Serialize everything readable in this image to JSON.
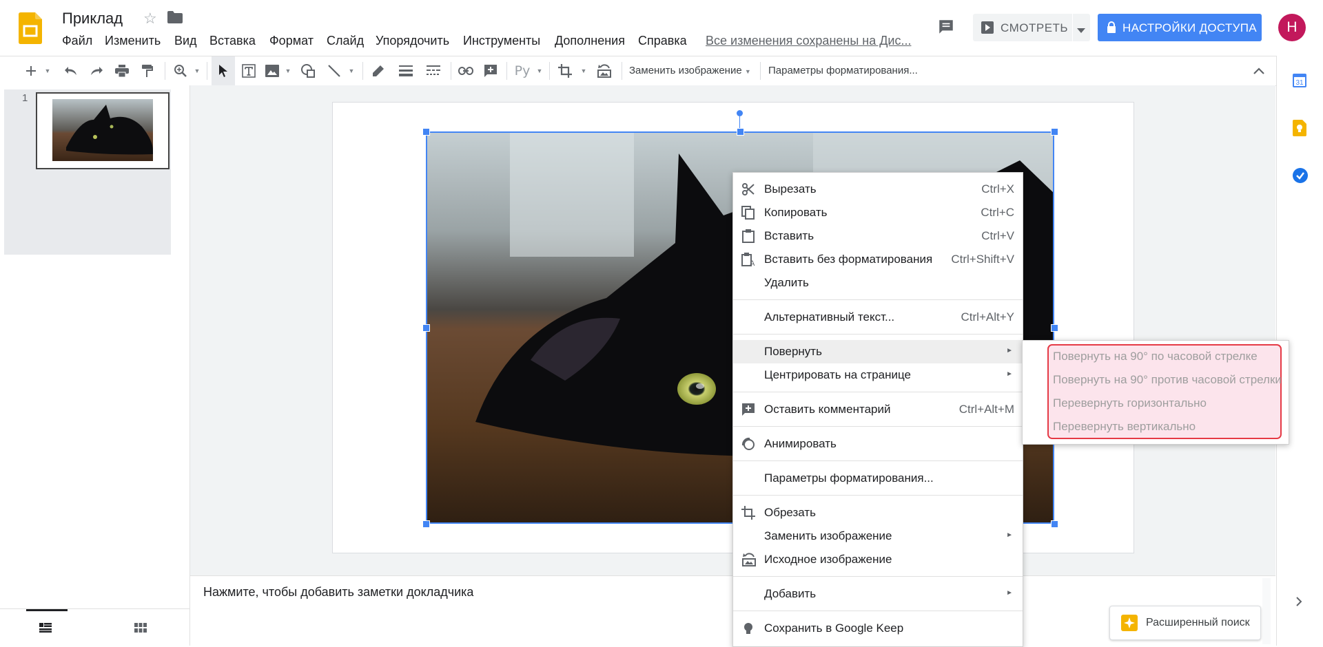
{
  "header": {
    "title": "Приклад",
    "menus": [
      "Файл",
      "Изменить",
      "Вид",
      "Вставка",
      "Формат",
      "Слайд",
      "Упорядочить",
      "Инструменты",
      "Дополнения",
      "Справка"
    ],
    "save_status": "Все изменения сохранены на Дис...",
    "present_label": "СМОТРЕТЬ",
    "share_label": "НАСТРОЙКИ ДОСТУПА",
    "avatar_letter": "Н"
  },
  "toolbar": {
    "replace_image": "Заменить изображение",
    "format_options": "Параметры форматирования..."
  },
  "filmstrip": {
    "slide_number": "1"
  },
  "notes": {
    "placeholder": "Нажмите, чтобы добавить заметки докладчика"
  },
  "explore": {
    "label": "Расширенный поиск"
  },
  "context_menu": {
    "cut": {
      "label": "Вырезать",
      "shortcut": "Ctrl+X"
    },
    "copy": {
      "label": "Копировать",
      "shortcut": "Ctrl+C"
    },
    "paste": {
      "label": "Вставить",
      "shortcut": "Ctrl+V"
    },
    "paste_plain": {
      "label": "Вставить без форматирования",
      "shortcut": "Ctrl+Shift+V"
    },
    "delete": {
      "label": "Удалить"
    },
    "alt_text": {
      "label": "Альтернативный текст...",
      "shortcut": "Ctrl+Alt+Y"
    },
    "rotate": {
      "label": "Повернуть"
    },
    "center": {
      "label": "Центрировать на странице"
    },
    "comment": {
      "label": "Оставить комментарий",
      "shortcut": "Ctrl+Alt+M"
    },
    "animate": {
      "label": "Анимировать"
    },
    "format_options": {
      "label": "Параметры форматирования..."
    },
    "crop": {
      "label": "Обрезать"
    },
    "replace_image": {
      "label": "Заменить изображение"
    },
    "reset_image": {
      "label": "Исходное изображение"
    },
    "add": {
      "label": "Добавить"
    },
    "keep": {
      "label": "Сохранить в Google Keep"
    }
  },
  "rotate_submenu": {
    "cw": "Повернуть на 90° по часовой стрелке",
    "ccw": "Повернуть на 90° против часовой стрелки",
    "flip_h": "Перевернуть горизонтально",
    "flip_v": "Перевернуть вертикально"
  },
  "colors": {
    "accent": "#4285f4",
    "avatar": "#c2185b",
    "highlight_border": "#e53945",
    "highlight_fill": "#fce4ec"
  }
}
